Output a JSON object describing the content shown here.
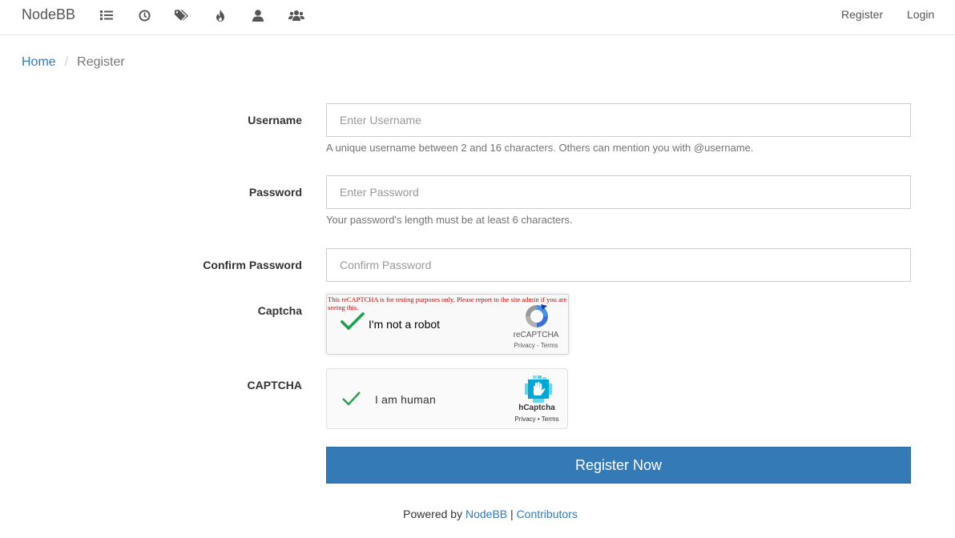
{
  "nav": {
    "brand": "NodeBB",
    "icons": [
      "categories-list-icon",
      "recent-clock-icon",
      "tags-icon",
      "popular-fire-icon",
      "users-icon",
      "groups-icon"
    ],
    "register": "Register",
    "login": "Login"
  },
  "breadcrumb": {
    "home": "Home",
    "separator": "/",
    "current": "Register"
  },
  "form": {
    "username": {
      "label": "Username",
      "placeholder": "Enter Username",
      "help": "A unique username between 2 and 16 characters. Others can mention you with @username."
    },
    "password": {
      "label": "Password",
      "placeholder": "Enter Password",
      "help": "Your password's length must be at least 6 characters."
    },
    "confirm": {
      "label": "Confirm Password",
      "placeholder": "Confirm Password"
    },
    "captcha_label": "Captcha",
    "recaptcha": {
      "warning": "This reCAPTCHA is for testing purposes only. Please report to the site admin if you are seeing this.",
      "text": "I'm not a robot",
      "brand": "reCAPTCHA",
      "terms": "Privacy - Terms"
    },
    "hcaptcha_label": "CAPTCHA",
    "hcaptcha": {
      "text": "I am human",
      "brand": "hCaptcha",
      "terms": "Privacy • Terms"
    },
    "submit": "Register Now"
  },
  "footer": {
    "powered": "Powered by",
    "nodebb": "NodeBB",
    "sep": "|",
    "contributors": "Contributors"
  },
  "colors": {
    "link": "#337ab7",
    "check_green": "#1e9f4a"
  }
}
